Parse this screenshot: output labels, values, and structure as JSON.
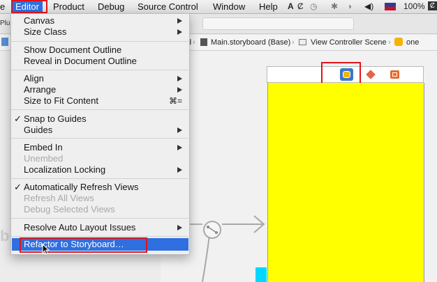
{
  "menubar": {
    "items": [
      "e",
      "Editor",
      "Product",
      "Debug",
      "Source Control",
      "Window",
      "Help"
    ],
    "active": "Editor",
    "status": {
      "battery": "100%",
      "extra": "Ȼ"
    }
  },
  "toolbar": {
    "left_text": "Plus"
  },
  "jumpbar": {
    "crumb_left": "d",
    "storyboard": "Main.storyboard (Base)",
    "scene": "View Controller Scene",
    "controller": "one"
  },
  "canvas": {
    "side_letter": "b"
  },
  "editor_menu": {
    "groups": [
      [
        {
          "label": "Canvas",
          "submenu": true
        },
        {
          "label": "Size Class",
          "submenu": true
        }
      ],
      [
        {
          "label": "Show Document Outline"
        },
        {
          "label": "Reveal in Document Outline"
        }
      ],
      [
        {
          "label": "Align",
          "submenu": true
        },
        {
          "label": "Arrange",
          "submenu": true
        },
        {
          "label": "Size to Fit Content",
          "shortcut": "⌘="
        }
      ],
      [
        {
          "label": "Snap to Guides",
          "checked": true
        },
        {
          "label": "Guides",
          "submenu": true
        }
      ],
      [
        {
          "label": "Embed In",
          "submenu": true
        },
        {
          "label": "Unembed",
          "disabled": true
        },
        {
          "label": "Localization Locking",
          "submenu": true
        }
      ],
      [
        {
          "label": "Automatically Refresh Views",
          "checked": true
        },
        {
          "label": "Refresh All Views",
          "disabled": true
        },
        {
          "label": "Debug Selected Views",
          "disabled": true
        }
      ],
      [
        {
          "label": "Resolve Auto Layout Issues",
          "submenu": true
        }
      ],
      [
        {
          "label": "Refactor to Storyboard…",
          "highlighted": true
        }
      ]
    ]
  },
  "colors": {
    "scene_background": "#ffff00",
    "highlight": "#2f6fe0",
    "annotation": "#e0141b"
  }
}
